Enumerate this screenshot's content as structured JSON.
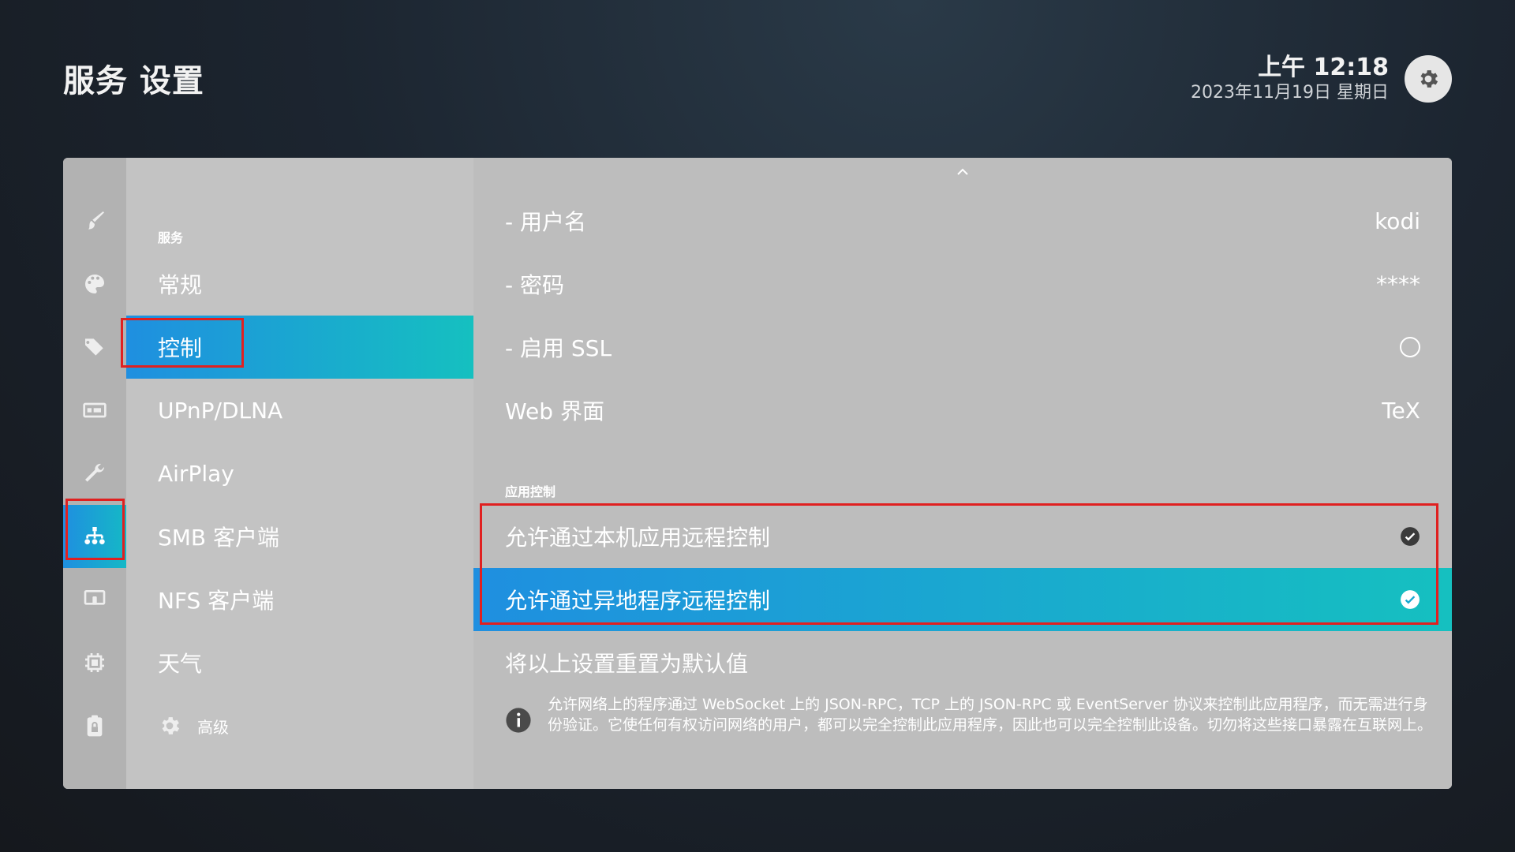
{
  "header": {
    "title": "服务 设置",
    "time": "上午 12:18",
    "date": "2023年11月19日 星期日",
    "settings_icon": "gear-icon"
  },
  "iconbar": {
    "items": [
      {
        "name": "brush-icon"
      },
      {
        "name": "palette-icon"
      },
      {
        "name": "tags-icon"
      },
      {
        "name": "display-icon"
      },
      {
        "name": "wrench-icon"
      },
      {
        "name": "network-icon",
        "active": true
      },
      {
        "name": "remote-display-icon"
      },
      {
        "name": "chip-icon"
      },
      {
        "name": "clipboard-lock-icon"
      }
    ]
  },
  "menu": {
    "section": "服务",
    "items": [
      {
        "label": "常规"
      },
      {
        "label": "控制",
        "active": true
      },
      {
        "label": "UPnP/DLNA"
      },
      {
        "label": "AirPlay"
      },
      {
        "label": "SMB 客户端"
      },
      {
        "label": "NFS 客户端"
      },
      {
        "label": "天气"
      }
    ],
    "level_label": "高级"
  },
  "content": {
    "rows": [
      {
        "label": "- 用户名",
        "value": "kodi"
      },
      {
        "label": "- 密码",
        "value": "****"
      },
      {
        "label": "- 启用 SSL",
        "state": "off"
      },
      {
        "label": "Web 界面",
        "value": "TeX"
      }
    ],
    "app_control_section": "应用控制",
    "app_control": [
      {
        "label": "允许通过本机应用远程控制",
        "state": "on"
      },
      {
        "label": "允许通过异地程序远程控制",
        "state": "on",
        "active": true
      }
    ],
    "reset_label": "将以上设置重置为默认值",
    "info_text": "允许网络上的程序通过 WebSocket 上的 JSON-RPC，TCP 上的 JSON-RPC 或 EventServer 协议来控制此应用程序，而无需进行身份验证。它使任何有权访问网络的用户，都可以完全控制此应用程序，因此也可以完全控制此设备。切勿将这些接口暴露在互联网上。"
  },
  "colors": {
    "accent_start": "#1f8fe0",
    "accent_end": "#15c0c0",
    "highlight_box": "#e02020",
    "panel_bg": "#bdbdbd"
  }
}
